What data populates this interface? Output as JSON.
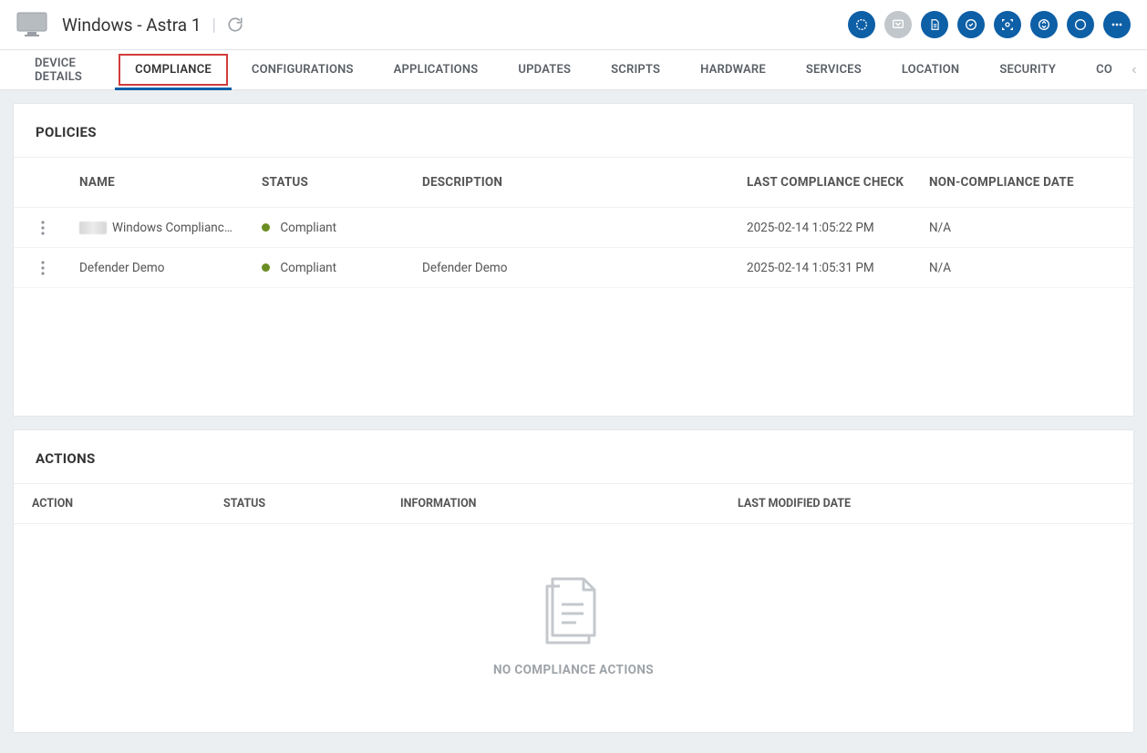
{
  "header": {
    "device_title": "Windows - Astra 1"
  },
  "tabs": [
    {
      "label": "DEVICE DETAILS",
      "active": false
    },
    {
      "label": "COMPLIANCE",
      "active": true
    },
    {
      "label": "CONFIGURATIONS",
      "active": false
    },
    {
      "label": "APPLICATIONS",
      "active": false
    },
    {
      "label": "UPDATES",
      "active": false
    },
    {
      "label": "SCRIPTS",
      "active": false
    },
    {
      "label": "HARDWARE",
      "active": false
    },
    {
      "label": "SERVICES",
      "active": false
    },
    {
      "label": "LOCATION",
      "active": false
    },
    {
      "label": "SECURITY",
      "active": false
    },
    {
      "label": "CO",
      "active": false
    }
  ],
  "policies": {
    "title": "POLICIES",
    "columns": {
      "name": "NAME",
      "status": "STATUS",
      "description": "DESCRIPTION",
      "last_check": "LAST COMPLIANCE CHECK",
      "noncompliance_date": "NON-COMPLIANCE DATE"
    },
    "rows": [
      {
        "name": "Windows Complianc…",
        "status": "Compliant",
        "description": "",
        "last_check": "2025-02-14 1:05:22 PM",
        "noncompliance_date": "N/A",
        "has_badge": true
      },
      {
        "name": "Defender Demo",
        "status": "Compliant",
        "description": "Defender Demo",
        "last_check": "2025-02-14 1:05:31 PM",
        "noncompliance_date": "N/A",
        "has_badge": false
      }
    ]
  },
  "actions": {
    "title": "ACTIONS",
    "columns": {
      "action": "ACTION",
      "status": "STATUS",
      "information": "INFORMATION",
      "last_modified": "LAST MODIFIED DATE"
    },
    "empty_message": "NO COMPLIANCE ACTIONS"
  },
  "colors": {
    "primary": "#0d5fa6",
    "highlight": "#d23b3b",
    "compliant_dot": "#6b8e23"
  }
}
